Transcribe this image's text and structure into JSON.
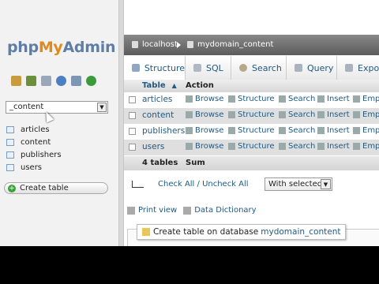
{
  "logo": {
    "part1": "php",
    "part2": "My",
    "part3": "Admin"
  },
  "nav_icons": [
    "home-icon",
    "database-icon",
    "sql-icon",
    "help-icon",
    "docs-icon",
    "reload-icon"
  ],
  "db_select": {
    "value": "_content"
  },
  "tables": [
    "articles",
    "content",
    "publishers",
    "users"
  ],
  "create_table": "Create table",
  "breadcrumb": {
    "server": "localhost",
    "database": "mydomain_content"
  },
  "tabs": [
    "Structure",
    "SQL",
    "Search",
    "Query",
    "Expo"
  ],
  "grid": {
    "header": {
      "table": "Table",
      "sort": "▲",
      "action": "Action"
    },
    "actions": [
      "Browse",
      "Structure",
      "Search",
      "Insert",
      "Emp"
    ],
    "rows": [
      "articles",
      "content",
      "publishers",
      "users"
    ],
    "summary": {
      "count": "4 tables",
      "sum": "Sum"
    }
  },
  "check_all": "Check All / Uncheck All",
  "with_selected": "With selected:",
  "print_view": "Print view",
  "data_dictionary": "Data Dictionary",
  "create_db": {
    "label": "Create table on database",
    "db": "mydomain_content"
  },
  "colors": {
    "link": "#235a81",
    "logo_blue": "#5f7ea5",
    "logo_orange": "#e0891d",
    "breadcrumb_bg": "#5c5c5c"
  }
}
